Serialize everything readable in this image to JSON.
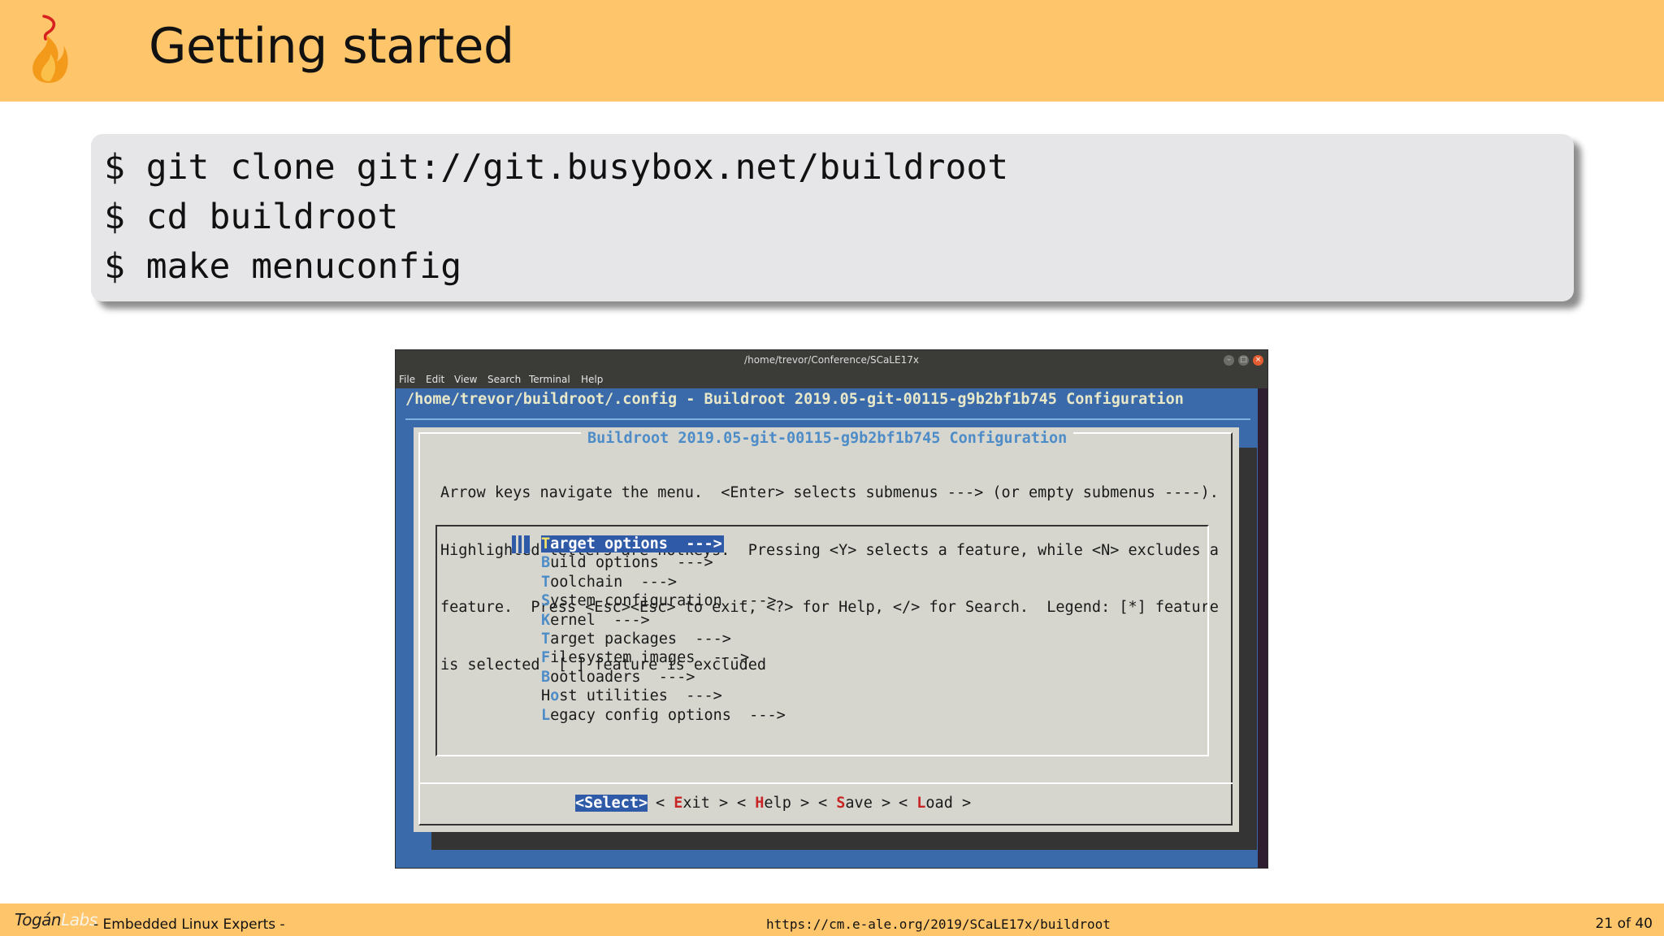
{
  "slide": {
    "title": "Getting started",
    "code_lines": [
      "$ git clone git://git.busybox.net/buildroot",
      "$ cd buildroot",
      "$ make menuconfig"
    ]
  },
  "terminal": {
    "window_title": "/home/trevor/Conference/SCaLE17x",
    "menu": [
      "File",
      "Edit",
      "View",
      "Search",
      "Terminal",
      "Help"
    ],
    "config_path": "/home/trevor/buildroot/.config - Buildroot 2019.05-git-00115-g9b2bf1b745 Configuration",
    "dialog_title": "Buildroot 2019.05-git-00115-g9b2bf1b745 Configuration",
    "help_lines": [
      "Arrow keys navigate the menu.  <Enter> selects submenus ---> (or empty submenus ----).",
      "Highlighted letters are hotkeys.  Pressing <Y> selects a feature, while <N> excludes a",
      "feature.  Press <Esc><Esc> to exit, <?> for Help, </> for Search.  Legend: [*] feature",
      "is selected  [ ] feature is excluded"
    ],
    "items": [
      {
        "pre": "",
        "hot": "T",
        "rest": "arget options  --->",
        "selected": true
      },
      {
        "pre": "",
        "hot": "B",
        "rest": "uild options  --->",
        "selected": false
      },
      {
        "pre": "",
        "hot": "T",
        "rest": "oolchain  --->",
        "selected": false
      },
      {
        "pre": "",
        "hot": "S",
        "rest": "ystem configuration  --->",
        "selected": false
      },
      {
        "pre": "",
        "hot": "K",
        "rest": "ernel  --->",
        "selected": false
      },
      {
        "pre": "",
        "hot": "T",
        "rest": "arget packages  --->",
        "selected": false
      },
      {
        "pre": "",
        "hot": "F",
        "rest": "ilesystem images  --->",
        "selected": false
      },
      {
        "pre": "",
        "hot": "B",
        "rest": "ootloaders  --->",
        "selected": false
      },
      {
        "pre": "H",
        "hot": "o",
        "rest": "st utilities  --->",
        "selected": false
      },
      {
        "pre": "",
        "hot": "L",
        "rest": "egacy config options  --->",
        "selected": false
      }
    ],
    "buttons": {
      "select": "<Select>",
      "exit_pre": "< ",
      "exit_hot": "E",
      "exit_rest": "xit >",
      "help_pre": "< ",
      "help_hot": "H",
      "help_rest": "elp >",
      "save_pre": "< ",
      "save_hot": "S",
      "save_rest": "ave >",
      "load_pre": "< ",
      "load_hot": "L",
      "load_rest": "oad >"
    }
  },
  "footer": {
    "brand_main": "Togán",
    "brand_labs": "Labs",
    "tagline": "- Embedded Linux Experts -",
    "url": "https://cm.e-ale.org/2019/SCaLE17x/buildroot",
    "page": "21 of 40"
  },
  "colors": {
    "band": "#fec56b",
    "terminal_bg": "#3a6aaa",
    "dialog_bg": "#d6d6cf",
    "hotkey_blue": "#4e8cc8",
    "hotkey_red": "#c82626"
  }
}
